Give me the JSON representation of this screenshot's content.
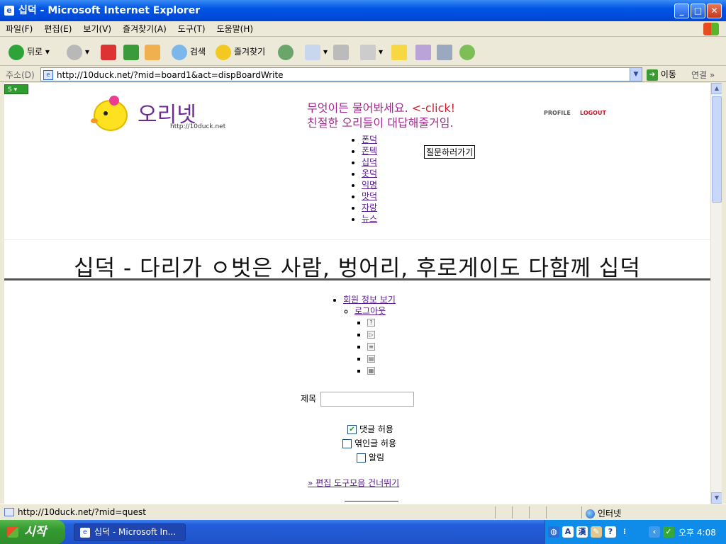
{
  "window": {
    "title": "십덕 - Microsoft Internet Explorer",
    "btn_min": "_",
    "btn_max": "□",
    "btn_close": "✕"
  },
  "menu": [
    "파일(F)",
    "편집(E)",
    "보기(V)",
    "즐겨찾기(A)",
    "도구(T)",
    "도움말(H)"
  ],
  "toolbar": {
    "back": "뒤로",
    "search": "검색",
    "favorites": "즐겨찾기"
  },
  "address": {
    "label": "주소(D)",
    "url": "http://10duck.net/?mid=board1&act=dispBoardWrite",
    "go": "이동",
    "links": "연결"
  },
  "page": {
    "logo_text": "오리넷",
    "logo_url": "http://10duck.net",
    "slogan_line1": "무엇이든 물어봐세요.",
    "slogan_click": "<-click!",
    "slogan_line2": "친절한 오리들이 대답해줄거임.",
    "profile": "PROFILE",
    "logout": "LOGOUT",
    "ask_button": "질문하러가기",
    "nav": [
      "폰덕",
      "폰텍",
      "십덕",
      "옷덕",
      "익명",
      "맛덕",
      "자랑",
      "뉴스"
    ],
    "board_title": "십덕 - 다리가 ㅇ벗은 사람, 벙어리, 후로게이도 다함께 십덕",
    "member_info": "회원 정보 보기",
    "member_logout": "로그아웃",
    "title_label": "제목",
    "checkboxes": [
      {
        "label": "댓글 허용",
        "checked": true
      },
      {
        "label": "엮인글 허용",
        "checked": false
      },
      {
        "label": "알림",
        "checked": false
      }
    ],
    "skip_link": "» 편집 도구모음 건너뛰기"
  },
  "status": {
    "text": "http://10duck.net/?mid=quest",
    "zone": "인터넷"
  },
  "taskbar": {
    "start": "시작",
    "item": "십덕 - Microsoft In...",
    "clock": "오후 4:08"
  }
}
